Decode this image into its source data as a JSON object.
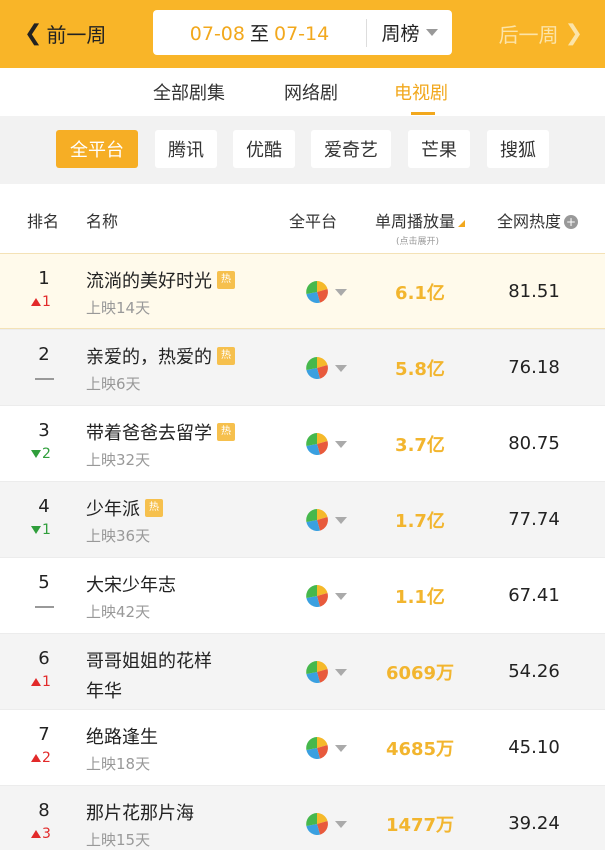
{
  "topbar": {
    "prev_label": "前一周",
    "next_label": "后一周",
    "date_start": "07-08",
    "date_to": "至",
    "date_end": "07-14",
    "period_label": "周榜"
  },
  "category_tabs": [
    {
      "label": "全部剧集",
      "active": false
    },
    {
      "label": "网络剧",
      "active": false
    },
    {
      "label": "电视剧",
      "active": true
    }
  ],
  "platforms": [
    {
      "label": "全平台",
      "active": true
    },
    {
      "label": "腾讯",
      "active": false
    },
    {
      "label": "优酷",
      "active": false
    },
    {
      "label": "爱奇艺",
      "active": false
    },
    {
      "label": "芒果",
      "active": false
    },
    {
      "label": "搜狐",
      "active": false
    }
  ],
  "table_header": {
    "rank": "排名",
    "name": "名称",
    "platform": "全平台",
    "weekly_views": "单周播放量",
    "weekly_views_hint": "(点击展开)",
    "heat": "全网热度"
  },
  "badge_text": "热",
  "rows": [
    {
      "rank": "1",
      "change_dir": "up",
      "change": "1",
      "title": [
        "流淌的美好时光"
      ],
      "badge": true,
      "sub": "上映14天",
      "views": "6.1亿",
      "heat": "81.51"
    },
    {
      "rank": "2",
      "change_dir": "flat",
      "change": "",
      "title": [
        "亲爱的，热爱的"
      ],
      "badge": true,
      "sub": "上映6天",
      "views": "5.8亿",
      "heat": "76.18"
    },
    {
      "rank": "3",
      "change_dir": "down",
      "change": "2",
      "title": [
        "带着爸爸去留学"
      ],
      "badge": true,
      "sub": "上映32天",
      "views": "3.7亿",
      "heat": "80.75"
    },
    {
      "rank": "4",
      "change_dir": "down",
      "change": "1",
      "title": [
        "少年派"
      ],
      "badge": true,
      "sub": "上映36天",
      "views": "1.7亿",
      "heat": "77.74"
    },
    {
      "rank": "5",
      "change_dir": "flat",
      "change": "",
      "title": [
        "大宋少年志"
      ],
      "badge": false,
      "sub": "上映42天",
      "views": "1.1亿",
      "heat": "67.41"
    },
    {
      "rank": "6",
      "change_dir": "up",
      "change": "1",
      "title": [
        "哥哥姐姐的花样",
        "年华"
      ],
      "badge": false,
      "sub": "",
      "views": "6069万",
      "heat": "54.26"
    },
    {
      "rank": "7",
      "change_dir": "up",
      "change": "2",
      "title": [
        "绝路逢生"
      ],
      "badge": false,
      "sub": "上映18天",
      "views": "4685万",
      "heat": "45.10"
    },
    {
      "rank": "8",
      "change_dir": "up",
      "change": "3",
      "title": [
        "那片花那片海"
      ],
      "badge": false,
      "sub": "上映15天",
      "views": "1477万",
      "heat": "39.24"
    }
  ],
  "colors": {
    "brand": "#f9b528",
    "accent": "#f2a81d",
    "views": "#f2b52e",
    "up": "#e22a2a",
    "down": "#2f9e3b",
    "pie": [
      "#f5b92a",
      "#e85a3c",
      "#3aa0e0",
      "#46b84c"
    ]
  },
  "icons": {
    "prev": "chevron-left-icon",
    "next": "chevron-right-icon",
    "period_dropdown": "caret-down-icon",
    "sort": "sort-triangle-icon",
    "info": "info-circle-icon",
    "platform_share": "pie-chart-icon",
    "rank_up": "arrow-up-icon",
    "rank_down": "arrow-down-icon"
  }
}
